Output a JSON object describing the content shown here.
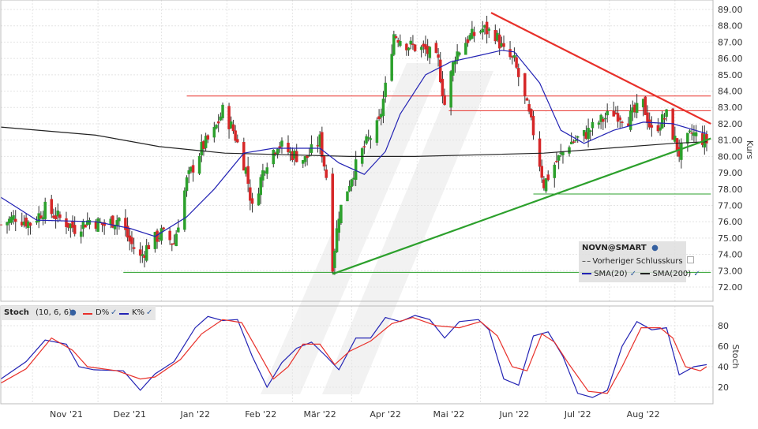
{
  "chart_data": [
    {
      "type": "candlestick",
      "instrument": "NOVN@SMART",
      "ylabel": "Kurs",
      "ylim": [
        71.5,
        89.2
      ],
      "y_ticks": [
        "89.00",
        "88.00",
        "87.00",
        "86.00",
        "85.00",
        "84.00",
        "83.00",
        "82.00",
        "81.00",
        "80.00",
        "79.00",
        "78.00",
        "77.00",
        "76.00",
        "75.00",
        "74.00",
        "73.00",
        "72.00"
      ],
      "x_ticks": [
        "Nov '21",
        "Dez '21",
        "Jan '22",
        "Feb '22",
        "Mär '22",
        "Apr '22",
        "Mai '22",
        "Jun '22",
        "Jul '22",
        "Aug '22"
      ],
      "legend": {
        "title": "NOVN@SMART",
        "previous_close": "Vorheriger Schlusskurs",
        "sma20": "SMA(20)",
        "sma200": "SMA(200)"
      },
      "close_path": [
        [
          "2021-10-01",
          75.8
        ],
        [
          "2021-10-08",
          76.3
        ],
        [
          "2021-10-15",
          75.9
        ],
        [
          "2021-10-22",
          76.8
        ],
        [
          "2021-10-29",
          76.2
        ],
        [
          "2021-11-05",
          75.6
        ],
        [
          "2021-11-12",
          76.1
        ],
        [
          "2021-11-19",
          75.8
        ],
        [
          "2021-11-26",
          76.2
        ],
        [
          "2021-12-01",
          74.8
        ],
        [
          "2021-12-06",
          73.8
        ],
        [
          "2021-12-10",
          74.6
        ],
        [
          "2021-12-16",
          75.3
        ],
        [
          "2021-12-22",
          74.7
        ],
        [
          "2021-12-28",
          78.5
        ],
        [
          "2022-01-04",
          80.5
        ],
        [
          "2022-01-10",
          81.5
        ],
        [
          "2022-01-14",
          82.8
        ],
        [
          "2022-01-19",
          81.6
        ],
        [
          "2022-01-25",
          79.2
        ],
        [
          "2022-01-28",
          76.8
        ],
        [
          "2022-02-03",
          79.5
        ],
        [
          "2022-02-09",
          80.8
        ],
        [
          "2022-02-15",
          80.2
        ],
        [
          "2022-02-22",
          79.8
        ],
        [
          "2022-03-01",
          81.0
        ],
        [
          "2022-03-04",
          78.8
        ],
        [
          "2022-03-07",
          73.4
        ],
        [
          "2022-03-10",
          76.5
        ],
        [
          "2022-03-16",
          78.8
        ],
        [
          "2022-03-22",
          80.6
        ],
        [
          "2022-03-29",
          82.0
        ],
        [
          "2022-04-01",
          84.2
        ],
        [
          "2022-04-05",
          87.5
        ],
        [
          "2022-04-12",
          86.8
        ],
        [
          "2022-04-20",
          86.5
        ],
        [
          "2022-04-26",
          85.8
        ],
        [
          "2022-04-29",
          83.2
        ],
        [
          "2022-05-04",
          86.2
        ],
        [
          "2022-05-10",
          87.2
        ],
        [
          "2022-05-17",
          87.8
        ],
        [
          "2022-05-23",
          87.5
        ],
        [
          "2022-05-27",
          86.4
        ],
        [
          "2022-06-01",
          85.8
        ],
        [
          "2022-06-06",
          83.5
        ],
        [
          "2022-06-10",
          81.5
        ],
        [
          "2022-06-15",
          78.3
        ],
        [
          "2022-06-20",
          79.5
        ],
        [
          "2022-06-27",
          80.8
        ],
        [
          "2022-07-04",
          81.3
        ],
        [
          "2022-07-11",
          82.1
        ],
        [
          "2022-07-18",
          82.7
        ],
        [
          "2022-07-25",
          82.3
        ],
        [
          "2022-08-01",
          83.2
        ],
        [
          "2022-08-05",
          81.5
        ],
        [
          "2022-08-12",
          82.5
        ],
        [
          "2022-08-18",
          80.2
        ],
        [
          "2022-08-24",
          81.4
        ],
        [
          "2022-08-31",
          80.9
        ]
      ],
      "sma20_path": [
        [
          "2021-10-01",
          77.5
        ],
        [
          "2021-10-18",
          76.1
        ],
        [
          "2021-11-15",
          76.0
        ],
        [
          "2021-12-01",
          75.6
        ],
        [
          "2021-12-13",
          75.1
        ],
        [
          "2021-12-28",
          76.3
        ],
        [
          "2022-01-10",
          78.0
        ],
        [
          "2022-01-24",
          80.2
        ],
        [
          "2022-02-07",
          80.5
        ],
        [
          "2022-03-01",
          80.5
        ],
        [
          "2022-03-10",
          79.6
        ],
        [
          "2022-03-22",
          78.9
        ],
        [
          "2022-04-01",
          80.3
        ],
        [
          "2022-04-08",
          82.6
        ],
        [
          "2022-04-20",
          85.0
        ],
        [
          "2022-05-02",
          85.8
        ],
        [
          "2022-05-16",
          86.2
        ],
        [
          "2022-05-26",
          86.5
        ],
        [
          "2022-06-01",
          86.4
        ],
        [
          "2022-06-13",
          84.5
        ],
        [
          "2022-06-23",
          81.6
        ],
        [
          "2022-07-04",
          80.8
        ],
        [
          "2022-07-18",
          81.6
        ],
        [
          "2022-08-01",
          82.1
        ],
        [
          "2022-08-15",
          82.0
        ],
        [
          "2022-08-31",
          81.4
        ]
      ],
      "sma200_path": [
        [
          "2021-10-01",
          81.8
        ],
        [
          "2021-11-15",
          81.3
        ],
        [
          "2021-12-15",
          80.6
        ],
        [
          "2022-01-15",
          80.2
        ],
        [
          "2022-02-15",
          80.1
        ],
        [
          "2022-03-15",
          80.0
        ],
        [
          "2022-04-15",
          80.0
        ],
        [
          "2022-05-15",
          80.1
        ],
        [
          "2022-06-15",
          80.2
        ],
        [
          "2022-07-15",
          80.5
        ],
        [
          "2022-08-15",
          80.8
        ],
        [
          "2022-08-31",
          80.9
        ]
      ],
      "trendlines": {
        "support_rising": {
          "color": "#2ca02c",
          "points": [
            [
              "2022-03-07",
              72.8
            ],
            [
              "2022-09-02",
              81.1
            ]
          ]
        },
        "resistance_falling": {
          "color": "#e8302a",
          "points": [
            [
              "2022-05-21",
              88.8
            ],
            [
              "2022-09-02",
              82.0
            ]
          ]
        },
        "horizontal_red": [
          {
            "from": "2021-12-28",
            "to": "2022-09-02",
            "y": 83.7
          },
          {
            "from": "2022-05-01",
            "to": "2022-09-02",
            "y": 82.8
          }
        ],
        "horizontal_green": [
          {
            "from": "2021-11-28",
            "to": "2022-09-02",
            "y": 72.9
          },
          {
            "from": "2022-06-10",
            "to": "2022-09-02",
            "y": 77.7
          }
        ]
      }
    },
    {
      "type": "line",
      "indicator": "Stoch",
      "params": "(10, 6, 6)",
      "ylabel": "Stoch",
      "ylim": [
        8,
        92
      ],
      "y_ticks": [
        "80",
        "60",
        "40",
        "20"
      ],
      "legend": [
        "D%",
        "K%"
      ],
      "series": [
        {
          "name": "K%",
          "color": "#2323b4",
          "points": [
            [
              "2021-10-01",
              28
            ],
            [
              "2021-10-13",
              45
            ],
            [
              "2021-10-22",
              66
            ],
            [
              "2021-11-01",
              62
            ],
            [
              "2021-11-07",
              40
            ],
            [
              "2021-11-14",
              37
            ],
            [
              "2021-11-28",
              36
            ],
            [
              "2021-12-06",
              17
            ],
            [
              "2021-12-13",
              33
            ],
            [
              "2021-12-22",
              45
            ],
            [
              "2022-01-01",
              78
            ],
            [
              "2022-01-07",
              89
            ],
            [
              "2022-01-14",
              85
            ],
            [
              "2022-01-21",
              86
            ],
            [
              "2022-01-28",
              50
            ],
            [
              "2022-02-04",
              20
            ],
            [
              "2022-02-11",
              44
            ],
            [
              "2022-02-18",
              58
            ],
            [
              "2022-02-25",
              64
            ],
            [
              "2022-03-04",
              50
            ],
            [
              "2022-03-10",
              37
            ],
            [
              "2022-03-18",
              68
            ],
            [
              "2022-03-25",
              68
            ],
            [
              "2022-04-01",
              88
            ],
            [
              "2022-04-08",
              84
            ],
            [
              "2022-04-15",
              90
            ],
            [
              "2022-04-22",
              86
            ],
            [
              "2022-04-29",
              68
            ],
            [
              "2022-05-06",
              84
            ],
            [
              "2022-05-15",
              86
            ],
            [
              "2022-05-20",
              76
            ],
            [
              "2022-05-27",
              28
            ],
            [
              "2022-06-03",
              22
            ],
            [
              "2022-06-10",
              70
            ],
            [
              "2022-06-17",
              74
            ],
            [
              "2022-06-24",
              50
            ],
            [
              "2022-07-01",
              14
            ],
            [
              "2022-07-08",
              10
            ],
            [
              "2022-07-15",
              17
            ],
            [
              "2022-07-22",
              60
            ],
            [
              "2022-07-29",
              84
            ],
            [
              "2022-08-05",
              76
            ],
            [
              "2022-08-12",
              78
            ],
            [
              "2022-08-18",
              32
            ],
            [
              "2022-08-25",
              40
            ],
            [
              "2022-08-31",
              42
            ]
          ]
        },
        {
          "name": "D%",
          "color": "#e8302a",
          "points": [
            [
              "2021-10-01",
              24
            ],
            [
              "2021-10-13",
              38
            ],
            [
              "2021-10-25",
              68
            ],
            [
              "2021-11-04",
              56
            ],
            [
              "2021-11-11",
              40
            ],
            [
              "2021-11-25",
              36
            ],
            [
              "2021-12-06",
              28
            ],
            [
              "2021-12-13",
              30
            ],
            [
              "2021-12-25",
              47
            ],
            [
              "2022-01-04",
              72
            ],
            [
              "2022-01-14",
              86
            ],
            [
              "2022-01-23",
              83
            ],
            [
              "2022-01-31",
              54
            ],
            [
              "2022-02-07",
              28
            ],
            [
              "2022-02-14",
              40
            ],
            [
              "2022-02-21",
              62
            ],
            [
              "2022-03-01",
              62
            ],
            [
              "2022-03-08",
              42
            ],
            [
              "2022-03-15",
              55
            ],
            [
              "2022-03-25",
              65
            ],
            [
              "2022-04-04",
              82
            ],
            [
              "2022-04-14",
              88
            ],
            [
              "2022-04-25",
              80
            ],
            [
              "2022-05-06",
              78
            ],
            [
              "2022-05-16",
              84
            ],
            [
              "2022-05-24",
              70
            ],
            [
              "2022-05-31",
              40
            ],
            [
              "2022-06-07",
              36
            ],
            [
              "2022-06-14",
              72
            ],
            [
              "2022-06-20",
              64
            ],
            [
              "2022-06-27",
              42
            ],
            [
              "2022-07-06",
              16
            ],
            [
              "2022-07-15",
              14
            ],
            [
              "2022-07-22",
              40
            ],
            [
              "2022-07-31",
              78
            ],
            [
              "2022-08-09",
              78
            ],
            [
              "2022-08-15",
              68
            ],
            [
              "2022-08-21",
              40
            ],
            [
              "2022-08-28",
              36
            ],
            [
              "2022-08-31",
              40
            ]
          ]
        }
      ]
    }
  ]
}
